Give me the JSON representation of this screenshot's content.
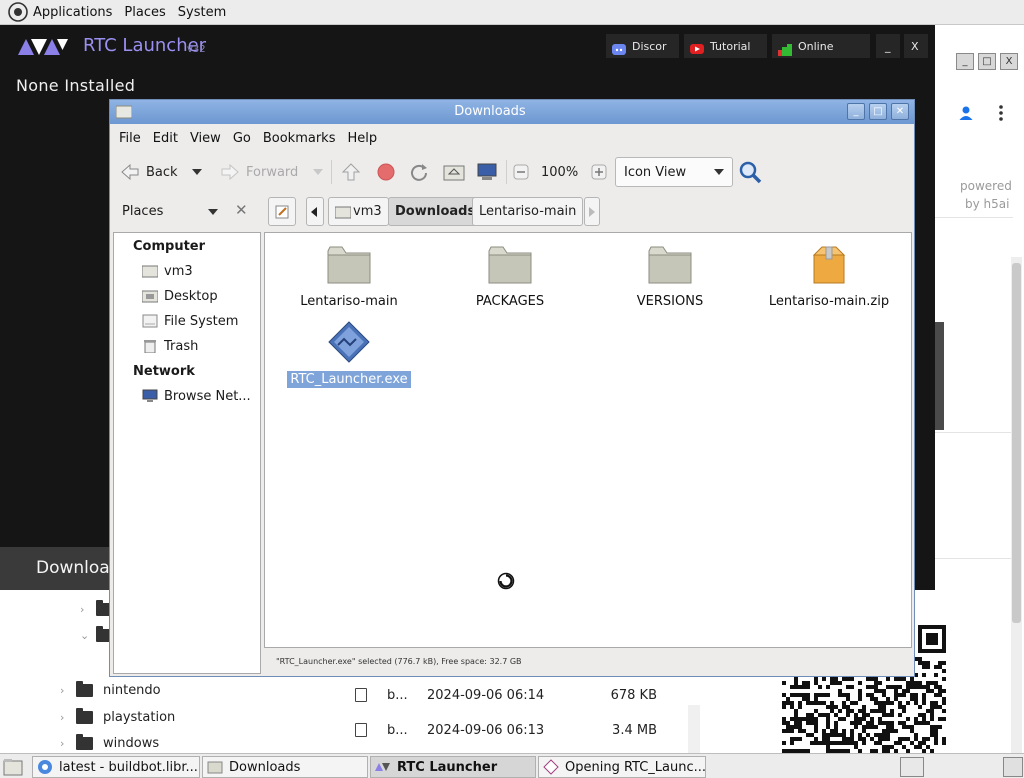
{
  "top_panel": {
    "menus": [
      "Applications",
      "Places",
      "System"
    ]
  },
  "background_browser": {
    "powered_by_line1": "powered",
    "powered_by_line2": "by h5ai",
    "tree": [
      {
        "label": "nintendo"
      },
      {
        "label": "playstation"
      },
      {
        "label": "windows"
      }
    ],
    "files": [
      {
        "name": "b...",
        "date": "2024-09-06 06:14",
        "size": "678 KB"
      },
      {
        "name": "b...",
        "date": "2024-09-06 06:13",
        "size": "3.4 MB"
      }
    ],
    "window_controls": [
      "_",
      "□",
      "X"
    ]
  },
  "rtc_launcher": {
    "title": "RTC Launcher",
    "version": "v32",
    "buttons": {
      "discord": "Discor",
      "tutorial": "Tutorial",
      "online": "Online",
      "minimize": "_",
      "close": "X"
    },
    "status_text": "None Installed",
    "download_button": "Download",
    "accent_color": "#9a90f0"
  },
  "nautilus": {
    "title": "Downloads",
    "menubar": [
      "File",
      "Edit",
      "View",
      "Go",
      "Bookmarks",
      "Help"
    ],
    "toolbar": {
      "back": "Back",
      "forward": "Forward",
      "zoom": "100%",
      "view_mode": "Icon View"
    },
    "sidebar": {
      "selector_label": "Places",
      "sections": [
        {
          "heading": "Computer",
          "items": [
            "vm3",
            "Desktop",
            "File System",
            "Trash"
          ]
        },
        {
          "heading": "Network",
          "items": [
            "Browse Net..."
          ]
        }
      ]
    },
    "breadcrumbs": [
      "vm3",
      "Downloads",
      "Lentariso-main"
    ],
    "items": [
      {
        "label": "Lentariso-main",
        "icon": "folder-icon",
        "selected": false
      },
      {
        "label": "PACKAGES",
        "icon": "folder-icon",
        "selected": false
      },
      {
        "label": "VERSIONS",
        "icon": "folder-icon",
        "selected": false
      },
      {
        "label": "Lentariso-main.zip",
        "icon": "archive-icon",
        "selected": false
      },
      {
        "label": "RTC_Launcher.exe",
        "icon": "executable-icon",
        "selected": true
      }
    ],
    "status": "\"RTC_Launcher.exe\" selected (776.7 kB), Free space: 32.7 GB",
    "selection_color": "#7ea4da"
  },
  "taskbar": {
    "tasks": [
      {
        "label": "latest - buildbot.libr...",
        "active": false
      },
      {
        "label": "Downloads",
        "active": false
      },
      {
        "label": "RTC Launcher",
        "active": true
      },
      {
        "label": "Opening RTC_Launc...",
        "active": false
      }
    ]
  }
}
